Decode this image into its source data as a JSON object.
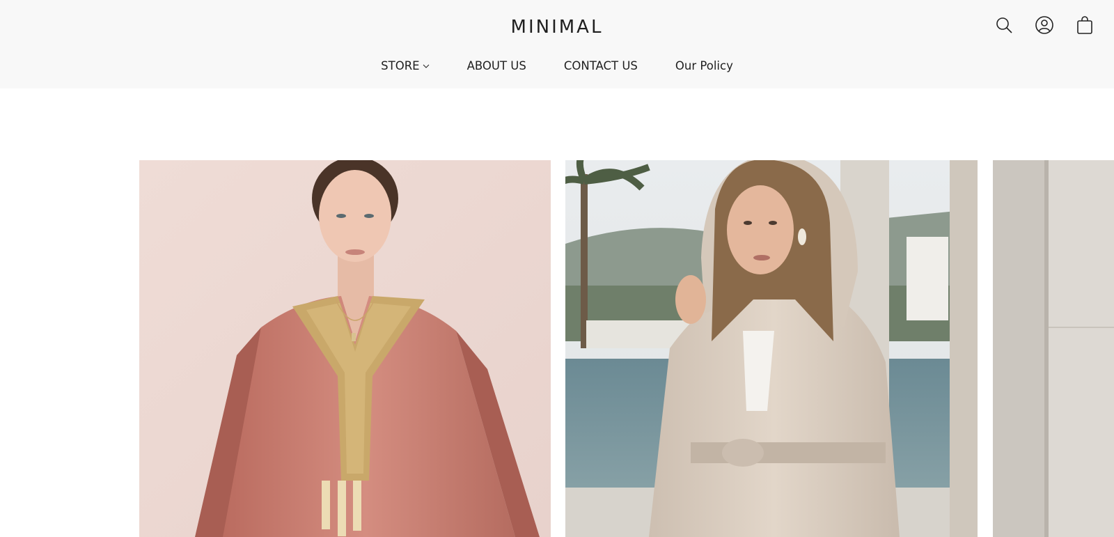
{
  "header": {
    "logo": "MINIMAL",
    "icons": [
      "search-icon",
      "account-icon",
      "cart-icon"
    ]
  },
  "nav": {
    "items": [
      {
        "label": "STORE",
        "has_dropdown": true
      },
      {
        "label": "ABOUT US"
      },
      {
        "label": "CONTACT US"
      },
      {
        "label": "Our Policy"
      }
    ]
  },
  "gallery": {
    "images": [
      {
        "name": "woman-in-rose-kaftan"
      },
      {
        "name": "woman-in-beige-hooded-robe"
      },
      {
        "name": "stone-column-partial"
      }
    ]
  },
  "colors": {
    "header_bg": "#f8f8f8",
    "text": "#1f1f1f",
    "page_bg": "#ffffff"
  }
}
